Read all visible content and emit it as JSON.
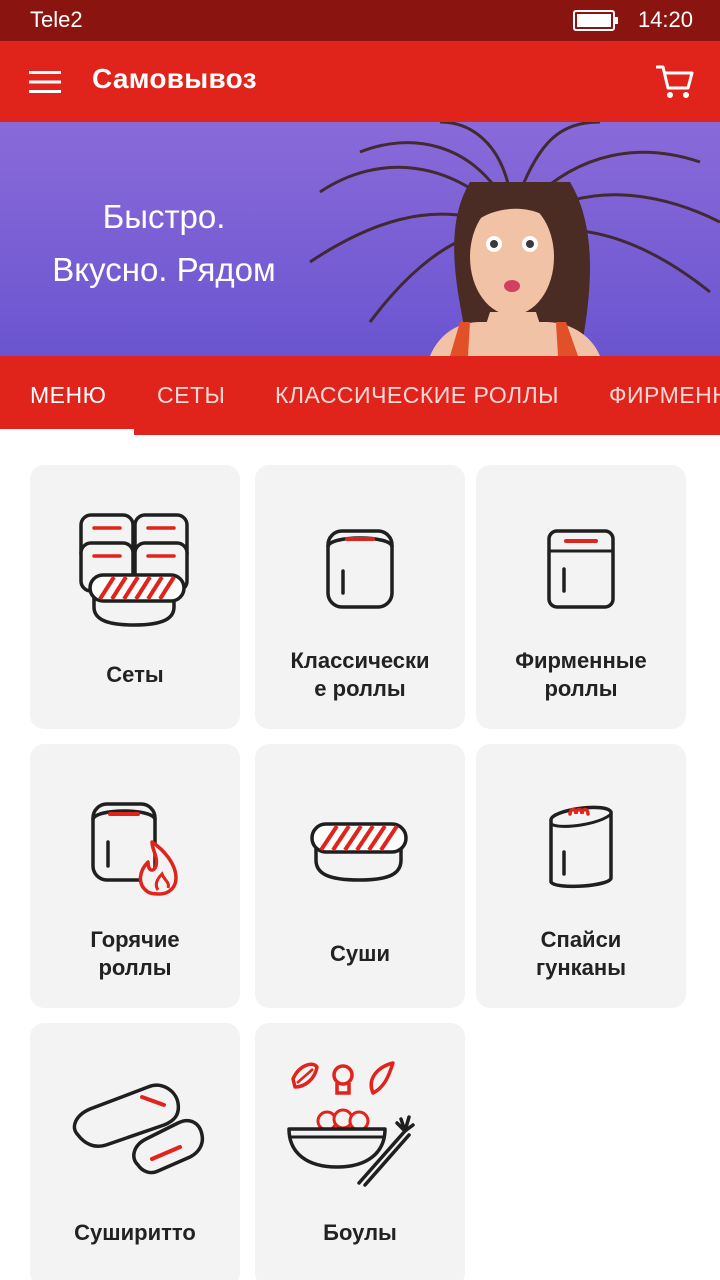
{
  "status_bar": {
    "carrier": "Tele2",
    "time": "14:20"
  },
  "app_bar": {
    "title": "Самовывоз",
    "menu_icon": "hamburger-menu-icon",
    "cart_icon": "cart-icon"
  },
  "banner": {
    "line1": "Быстро.",
    "line2": "Вкусно. Рядом"
  },
  "tabs": [
    {
      "label": "МЕНЮ",
      "active": true
    },
    {
      "label": "СЕТЫ",
      "active": false
    },
    {
      "label": "КЛАССИЧЕСКИЕ РОЛЛЫ",
      "active": false
    },
    {
      "label": "ФИРМЕННЫЕ РОЛЛЫ",
      "active": false
    }
  ],
  "categories": [
    {
      "label": "Сеты",
      "icon": "sets-icon"
    },
    {
      "label": "Классически\nе роллы",
      "icon": "classic-roll-icon"
    },
    {
      "label": "Фирменные\nроллы",
      "icon": "signature-roll-icon"
    },
    {
      "label": "Горячие\nроллы",
      "icon": "hot-roll-icon"
    },
    {
      "label": "Суши",
      "icon": "sushi-icon"
    },
    {
      "label": "Спайси\nгунканы",
      "icon": "gunkan-icon"
    },
    {
      "label": "Суширитто",
      "icon": "sushiritto-icon"
    },
    {
      "label": "Боулы",
      "icon": "bowl-icon"
    }
  ],
  "colors": {
    "primary": "#e0231b",
    "status_bar": "#8a1510",
    "banner": "#7560d6",
    "card": "#f3f3f3",
    "accent": "#e0231b"
  }
}
